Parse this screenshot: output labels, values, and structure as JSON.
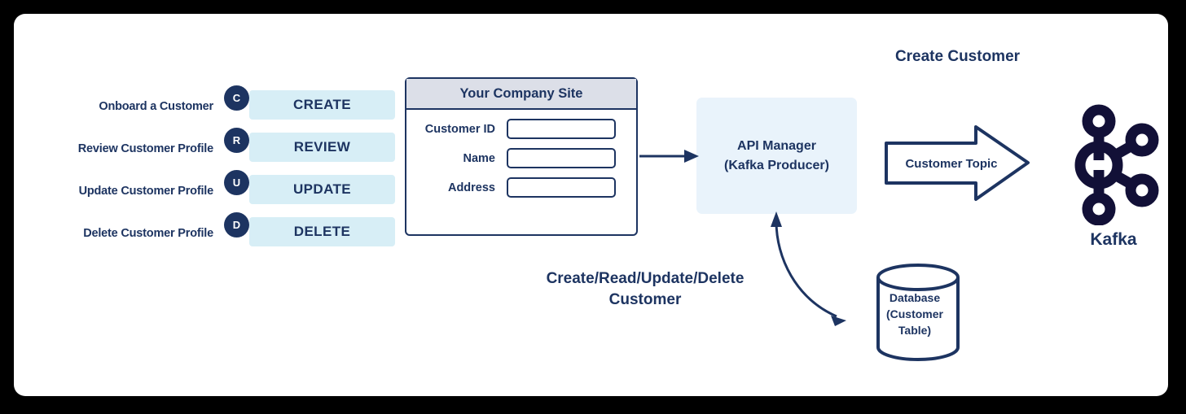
{
  "diagram": {
    "title_create_customer": "Create Customer",
    "crud_caption_line1": "Create/Read/Update/Delete",
    "crud_caption_line2": "Customer"
  },
  "crud": {
    "rows": [
      {
        "badge": "C",
        "operation": "CREATE",
        "description": "Onboard a Customer"
      },
      {
        "badge": "R",
        "operation": "REVIEW",
        "description": "Review Customer Profile"
      },
      {
        "badge": "U",
        "operation": "UPDATE",
        "description": "Update Customer Profile"
      },
      {
        "badge": "D",
        "operation": "DELETE",
        "description": "Delete Customer Profile"
      }
    ]
  },
  "site_panel": {
    "header": "Your Company Site",
    "fields": [
      {
        "label": "Customer ID",
        "value": ""
      },
      {
        "label": "Name",
        "value": ""
      },
      {
        "label": "Address",
        "value": ""
      }
    ]
  },
  "api_manager": {
    "line1": "API Manager",
    "line2": "(Kafka Producer)"
  },
  "topic_arrow": {
    "label": "Customer Topic"
  },
  "kafka": {
    "label": "Kafka",
    "icon": "kafka-logo-icon"
  },
  "database": {
    "line1": "Database",
    "line2": "(Customer",
    "line3": "Table)",
    "icon": "database-cylinder-icon"
  },
  "colors": {
    "navy": "#1d3461",
    "pill_blue": "#d7eef6",
    "api_box_blue": "#e9f3fb",
    "header_gray": "#dcdfe8",
    "kafka_logo": "#121037",
    "card_background": "#ffffff",
    "page_background": "#000000"
  }
}
